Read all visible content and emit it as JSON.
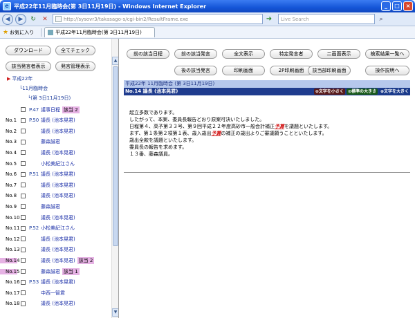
{
  "window": {
    "title": "平成22年11月臨時会(第 3日11月19日) - Windows Internet Explorer",
    "minimize": "_",
    "maximize": "□",
    "close": "×"
  },
  "address": {
    "url": "http://sysovr3/takasago-s/cgi-bin2/ResultFrame.exe",
    "search_placeholder": "Live Search"
  },
  "favorites": {
    "label": "お気に入り",
    "tab_title": "平成22年11月臨時会(第 3日11月19日)"
  },
  "left": {
    "buttons": {
      "download": "ダウンロード",
      "check_all": "全てチェック",
      "show_speakers": "該当発言者表示",
      "show_speech_list": "発言管理表示"
    },
    "tree": {
      "year": "平成22年",
      "session": "11月臨時会",
      "day": "(第 3日11月19日)"
    },
    "rows": [
      {
        "no": "",
        "page": "P.47",
        "speaker": "議事日程",
        "hit": "該当 2",
        "hl": false
      },
      {
        "no": "No.1",
        "page": "P.50",
        "speaker": "議長 (池本晃君)",
        "hit": "",
        "hl": false
      },
      {
        "no": "No.2",
        "page": "",
        "speaker": "議長 (池本晃君)",
        "hit": "",
        "hl": false
      },
      {
        "no": "No.3",
        "page": "",
        "speaker": "藤森誠君",
        "hit": "",
        "hl": false
      },
      {
        "no": "No.4",
        "page": "",
        "speaker": "議長 (池本晃君)",
        "hit": "",
        "hl": false
      },
      {
        "no": "No.5",
        "page": "",
        "speaker": "小松美紀江さん",
        "hit": "",
        "hl": false
      },
      {
        "no": "No.6",
        "page": "P.51",
        "speaker": "議長 (池本晃君)",
        "hit": "",
        "hl": false
      },
      {
        "no": "No.7",
        "page": "",
        "speaker": "議長 (池本晃君)",
        "hit": "",
        "hl": false
      },
      {
        "no": "No.8",
        "page": "",
        "speaker": "議長 (池本晃君)",
        "hit": "",
        "hl": false
      },
      {
        "no": "No.9",
        "page": "",
        "speaker": "藤森誠君",
        "hit": "",
        "hl": false
      },
      {
        "no": "No.10",
        "page": "",
        "speaker": "議長 (池本晃君)",
        "hit": "",
        "hl": false
      },
      {
        "no": "No.11",
        "page": "P.52",
        "speaker": "小松美紀江さん",
        "hit": "",
        "hl": false
      },
      {
        "no": "No.12",
        "page": "",
        "speaker": "議長 (池本晃君)",
        "hit": "",
        "hl": false
      },
      {
        "no": "No.13",
        "page": "",
        "speaker": "議長 (池本晃君)",
        "hit": "",
        "hl": false
      },
      {
        "no": "No.14",
        "page": "",
        "speaker": "議長 (池本晃君)",
        "hit": "該当 2",
        "hl": true
      },
      {
        "no": "No.15",
        "page": "",
        "speaker": "藤森誠君",
        "hit": "該当 1",
        "hl": true
      },
      {
        "no": "No.16",
        "page": "P.53",
        "speaker": "議長 (池本晃君)",
        "hit": "",
        "hl": false
      },
      {
        "no": "No.17",
        "page": "",
        "speaker": "中西一智君",
        "hit": "",
        "hl": false
      },
      {
        "no": "No.18",
        "page": "",
        "speaker": "議長 (池本晃君)",
        "hit": "",
        "hl": false
      }
    ]
  },
  "right": {
    "buttons": {
      "prev_schedule": "前の該当日程",
      "prev_speech": "前の該当発言",
      "show_all": "全文表示",
      "specific_speaker": "特定発言者",
      "two_screen": "二画面表示",
      "back_to_results": "検索結果一覧へ",
      "next_speech": "後の該当発言",
      "print_screen": "印刷画面",
      "print_2p": "2P印刷画面",
      "print_hits": "該当部印刷画面",
      "help": "操作説明へ"
    },
    "meeting_title": "平成22年 11月臨時会 (第 3日11月19日)",
    "speaker_title": "No.14 議長 (池本晃君)",
    "size": {
      "smaller": "⊖文字を小さく",
      "standard": "⊙標準の大きさ",
      "larger": "⊕文字を大きく"
    },
    "body": {
      "line1": "起立多数であります。",
      "line2": "したがって、本案、委員長報告どおり原案可決いたしました。",
      "line3_pre": "日程第４、高予第３３号、第９回平成２２年度高砂市一般会計補正",
      "line3_kw": "予算",
      "line3_post": "を議題といたします。",
      "line4_pre": "まず、第１条第２項第１表、歳入歳出",
      "line4_kw": "予算",
      "line4_post": "の補正の歳出よりご審議願うことといたします。",
      "line5": "歳出全款を議題といたします。",
      "line6": "委員長の報告を求めます。",
      "line7": "１３番、藤森議員。"
    }
  }
}
